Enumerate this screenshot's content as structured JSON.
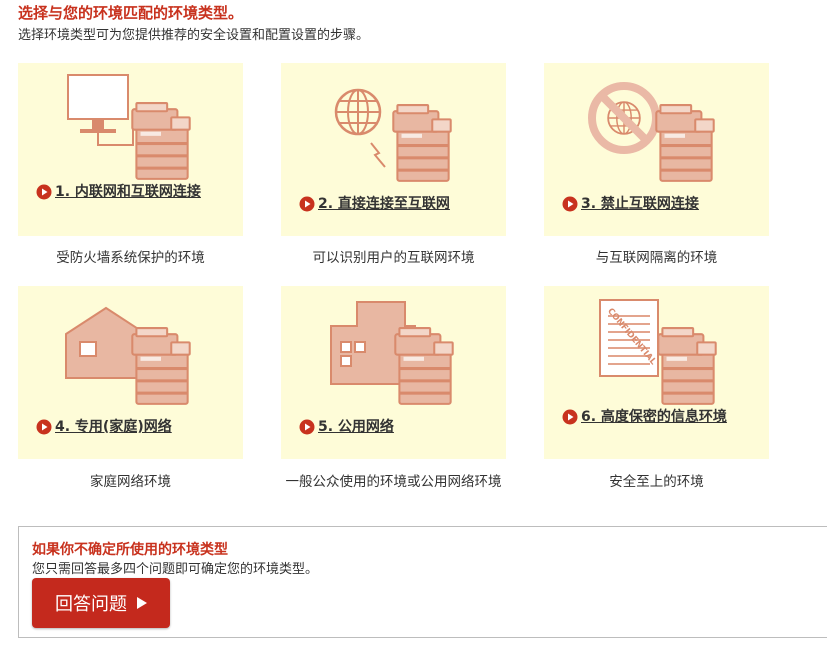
{
  "header": {
    "title": "选择与您的环境匹配的环境类型。",
    "subtitle": "选择环境类型可为您提供推荐的安全设置和配置设置的步骤。"
  },
  "cards": [
    {
      "label": "1. 内联网和互联网连接",
      "description": "受防火墙系统保护的环境",
      "icon": "monitor-printer-icon"
    },
    {
      "label": "2. 直接连接至互联网",
      "description": "可以识别用户的互联网环境",
      "icon": "globe-printer-icon"
    },
    {
      "label": "3. 禁止互联网连接",
      "description": "与互联网隔离的环境",
      "icon": "blocked-globe-printer-icon"
    },
    {
      "label": "4. 专用(家庭)网络",
      "description": "家庭网络环境",
      "icon": "house-printer-icon"
    },
    {
      "label": "5. 公用网络",
      "description": "一般公众使用的环境或公用网络环境",
      "icon": "building-printer-icon"
    },
    {
      "label": "6. 高度保密的信息环境",
      "description": "安全至上的环境",
      "icon": "confidential-printer-icon"
    }
  ],
  "confidential_stamp": "CONFIDENTIAL",
  "unsure": {
    "title": "如果你不确定所使用的环境类型",
    "subtitle": "您只需回答最多四个问题即可确定您的环境类型。",
    "button_label": "回答问题"
  },
  "colors": {
    "accent_red": "#c8321e",
    "card_bg": "#fefcd8",
    "illustration": "#d98a6c",
    "button_bg": "#c4291d"
  }
}
